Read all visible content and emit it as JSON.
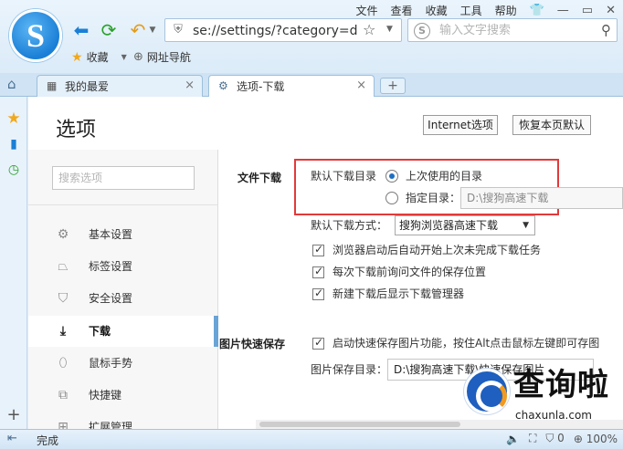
{
  "menu": {
    "file": "文件",
    "view": "查看",
    "favorites": "收藏",
    "tools": "工具",
    "help": "帮助"
  },
  "logo": {
    "letter": "S"
  },
  "address": {
    "url": "se://settings/?category=dov"
  },
  "search": {
    "placeholder": "输入文字搜索",
    "engine_letter": "S"
  },
  "bookmarks": {
    "favorites_label": "收藏",
    "site_nav_label": "网址导航"
  },
  "tabs": [
    {
      "label": "我的最爱",
      "close": "×"
    },
    {
      "label": "选项-下载",
      "close": "×"
    }
  ],
  "newtab": "+",
  "page": {
    "title": "选项",
    "internet_options": "Internet选项",
    "restore_defaults": "恢复本页默认",
    "search_placeholder": "搜索选项"
  },
  "sidebar_items": [
    {
      "label": "基本设置",
      "icon": "gear-icon"
    },
    {
      "label": "标签设置",
      "icon": "tab-icon"
    },
    {
      "label": "安全设置",
      "icon": "shield-icon"
    },
    {
      "label": "下载",
      "icon": "download-icon"
    },
    {
      "label": "鼠标手势",
      "icon": "mouse-icon"
    },
    {
      "label": "快捷键",
      "icon": "shortcut-icon"
    },
    {
      "label": "扩展管理",
      "icon": "extension-icon"
    }
  ],
  "download": {
    "section_label": "文件下载",
    "default_dir_label": "默认下载目录",
    "last_used": "上次使用的目录",
    "specify_dir": "指定目录：",
    "specify_path": "D:\\搜狗高速下载",
    "method_label": "默认下载方式：",
    "method_value": "搜狗浏览器高速下载",
    "check_resume": "浏览器启动后自动开始上次未完成下载任务",
    "check_ask": "每次下载前询问文件的保存位置",
    "check_show_mgr": "新建下载后显示下载管理器"
  },
  "image_save": {
    "section_label": "图片快速保存",
    "quick_save": "启动快速保存图片功能，按住Alt点击鼠标左键即可存图",
    "dir_label": "图片保存目录：",
    "dir_value": "D:\\搜狗高速下载\\快速保存图片"
  },
  "watermark": {
    "text": "查询啦",
    "domain": "chaxunla.com"
  },
  "status": {
    "text": "完成",
    "zoom": "100%",
    "count": "0"
  },
  "colors": {
    "accent": "#1a7fd6",
    "highlight": "#e2393a",
    "selected_bar": "#6aa3d6"
  }
}
